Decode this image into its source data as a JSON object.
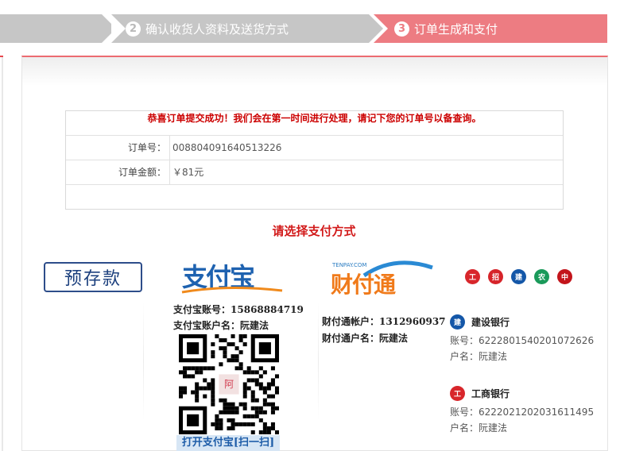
{
  "steps": [
    {
      "number": "",
      "label": ""
    },
    {
      "number": "2",
      "label": "确认收货人资料及送货方式"
    },
    {
      "number": "3",
      "label": "订单生成和支付"
    }
  ],
  "order": {
    "success_message": "恭喜订单提交成功！我们会在第一时间进行处理，请记下您的订单号以备查询。",
    "order_no_label": "订单号：",
    "order_no": "008804091640513226",
    "amount_label": "订单金额：",
    "amount": "￥81元"
  },
  "payment": {
    "title": "请选择支付方式",
    "prepaid_label": "预存款",
    "alipay_logo": "支付宝",
    "tenpay_logo_small": "TENPAY.COM",
    "tenpay_logo": "财付通",
    "bank_icons": [
      {
        "name": "icbc-icon",
        "color": "#d8262b",
        "glyph": "工"
      },
      {
        "name": "cmb-icon",
        "color": "#d6242a",
        "glyph": "招"
      },
      {
        "name": "ccb-icon",
        "color": "#1457a8",
        "glyph": "建"
      },
      {
        "name": "abc-icon",
        "color": "#1a9a5a",
        "glyph": "农"
      },
      {
        "name": "boc-icon",
        "color": "#c3141b",
        "glyph": "中"
      }
    ]
  },
  "alipay": {
    "account_label": "支付宝账号：",
    "account": "15868884719",
    "name_label": "支付宝账户名：",
    "name": "阮建法",
    "qr_caption": "打开支付宝[扫一扫]"
  },
  "tenpay": {
    "account_label": "财付通帐户：",
    "account": "1312960937",
    "name_label": "财付通户名：",
    "name": "阮建法"
  },
  "banks": [
    {
      "name": "建设银行",
      "account_label": "账号：",
      "account": "6222801540201072626",
      "holder_label": "户名：",
      "holder": "阮建法",
      "color": "#1457a8"
    },
    {
      "name": "工商银行",
      "account_label": "账号：",
      "account": "6222021202031611495",
      "holder_label": "户名：",
      "holder": "阮建法",
      "color": "#d8262b"
    }
  ],
  "colors": {
    "accent": "#ed7c82",
    "step_inactive": "#c6c6c6",
    "alert_red": "#cc0000"
  }
}
